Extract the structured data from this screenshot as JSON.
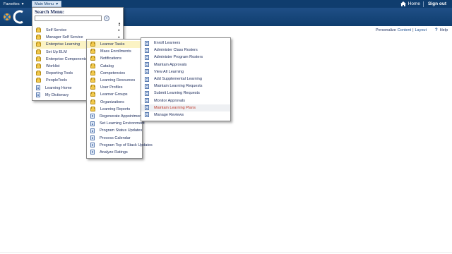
{
  "topbar": {
    "favorites_label": "Favorites",
    "main_menu_label": "Main Menu",
    "home_label": "Home",
    "signout_label": "Sign out"
  },
  "subbar": {
    "personalize_label": "Personalize",
    "content_label": "Content",
    "separator": "|",
    "layout_label": "Layout",
    "help_label": "Help"
  },
  "main_menu": {
    "search_label": "Search Menu:",
    "search_value": "",
    "items": [
      {
        "label": "Self Service",
        "icon": "folder-icon",
        "has_submenu": true
      },
      {
        "label": "Manager Self Service",
        "icon": "folder-icon",
        "has_submenu": true
      },
      {
        "label": "Enterprise Learning",
        "icon": "folder-icon",
        "has_submenu": true
      },
      {
        "label": "Set Up ELM",
        "icon": "folder-icon",
        "has_submenu": false
      },
      {
        "label": "Enterprise Components",
        "icon": "folder-icon",
        "has_submenu": false
      },
      {
        "label": "Worklist",
        "icon": "folder-icon",
        "has_submenu": false
      },
      {
        "label": "Reporting Tools",
        "icon": "folder-icon",
        "has_submenu": false
      },
      {
        "label": "PeopleTools",
        "icon": "folder-icon",
        "has_submenu": false
      },
      {
        "label": "Learning Home",
        "icon": "document-icon",
        "has_submenu": false
      },
      {
        "label": "My Dictionary",
        "icon": "document-icon",
        "has_submenu": false
      }
    ]
  },
  "learning_menu": {
    "items": [
      {
        "label": "Learner Tasks",
        "icon": "folder-icon"
      },
      {
        "label": "Mass Enrollments",
        "icon": "folder-icon"
      },
      {
        "label": "Notifications",
        "icon": "folder-icon"
      },
      {
        "label": "Catalog",
        "icon": "folder-icon"
      },
      {
        "label": "Competencies",
        "icon": "folder-icon"
      },
      {
        "label": "Learning Resources",
        "icon": "folder-icon"
      },
      {
        "label": "User Profiles",
        "icon": "folder-icon"
      },
      {
        "label": "Learner Groups",
        "icon": "folder-icon"
      },
      {
        "label": "Organizations",
        "icon": "folder-icon"
      },
      {
        "label": "Learning Reports",
        "icon": "folder-icon"
      },
      {
        "label": "Regenerate Appointment",
        "icon": "document-icon"
      },
      {
        "label": "Set Learning Environment",
        "icon": "document-icon"
      },
      {
        "label": "Program Status Updates",
        "icon": "document-icon"
      },
      {
        "label": "Process Calendar",
        "icon": "document-icon"
      },
      {
        "label": "Program Top of Stack Updates",
        "icon": "document-icon"
      },
      {
        "label": "Analyze Ratings",
        "icon": "document-icon"
      }
    ]
  },
  "learner_tasks_menu": {
    "items": [
      {
        "label": "Enroll Learners"
      },
      {
        "label": "Administer Class Rosters"
      },
      {
        "label": "Administer Program Rosters"
      },
      {
        "label": "Maintain Approvals"
      },
      {
        "label": "View All Learning"
      },
      {
        "label": "Add Supplemental Learning"
      },
      {
        "label": "Maintain Learning Requests"
      },
      {
        "label": "Submit Learning Requests"
      },
      {
        "label": "Monitor Approvals"
      },
      {
        "label": "Maintain Learning Plans"
      },
      {
        "label": "Manage Reviews"
      }
    ]
  },
  "colors": {
    "topbar": "#0f3d6e",
    "highlight": "#fbf3c4",
    "hover_text": "#c0392b"
  }
}
